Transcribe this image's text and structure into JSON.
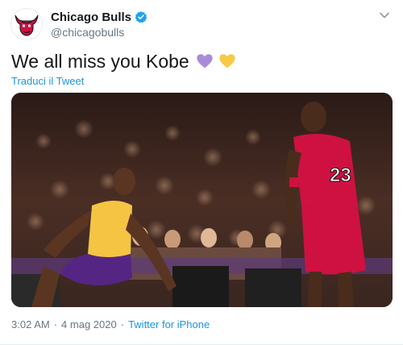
{
  "account": {
    "display_name": "Chicago Bulls",
    "handle": "@chicagobulls",
    "avatar_icon": "bulls-logo-icon",
    "verified_icon": "verified-badge-icon"
  },
  "tweet": {
    "text": "We all miss you Kobe",
    "emojis": [
      "purple-heart-icon",
      "yellow-heart-icon"
    ],
    "translate_label": "Traduci il Tweet",
    "media_alt": "basketball-photo"
  },
  "footer": {
    "time": "3:02 AM",
    "separator": "·",
    "date": "4 mag 2020",
    "source": "Twitter for iPhone"
  },
  "colors": {
    "link": "#1b95e0",
    "secondary_text": "#657786",
    "verified": "#1da1f2",
    "purple_heart": "#a98bd8",
    "yellow_heart": "#f7c948",
    "bulls_red": "#ce1141",
    "lakers_gold": "#f5c443",
    "lakers_purple": "#552583"
  }
}
